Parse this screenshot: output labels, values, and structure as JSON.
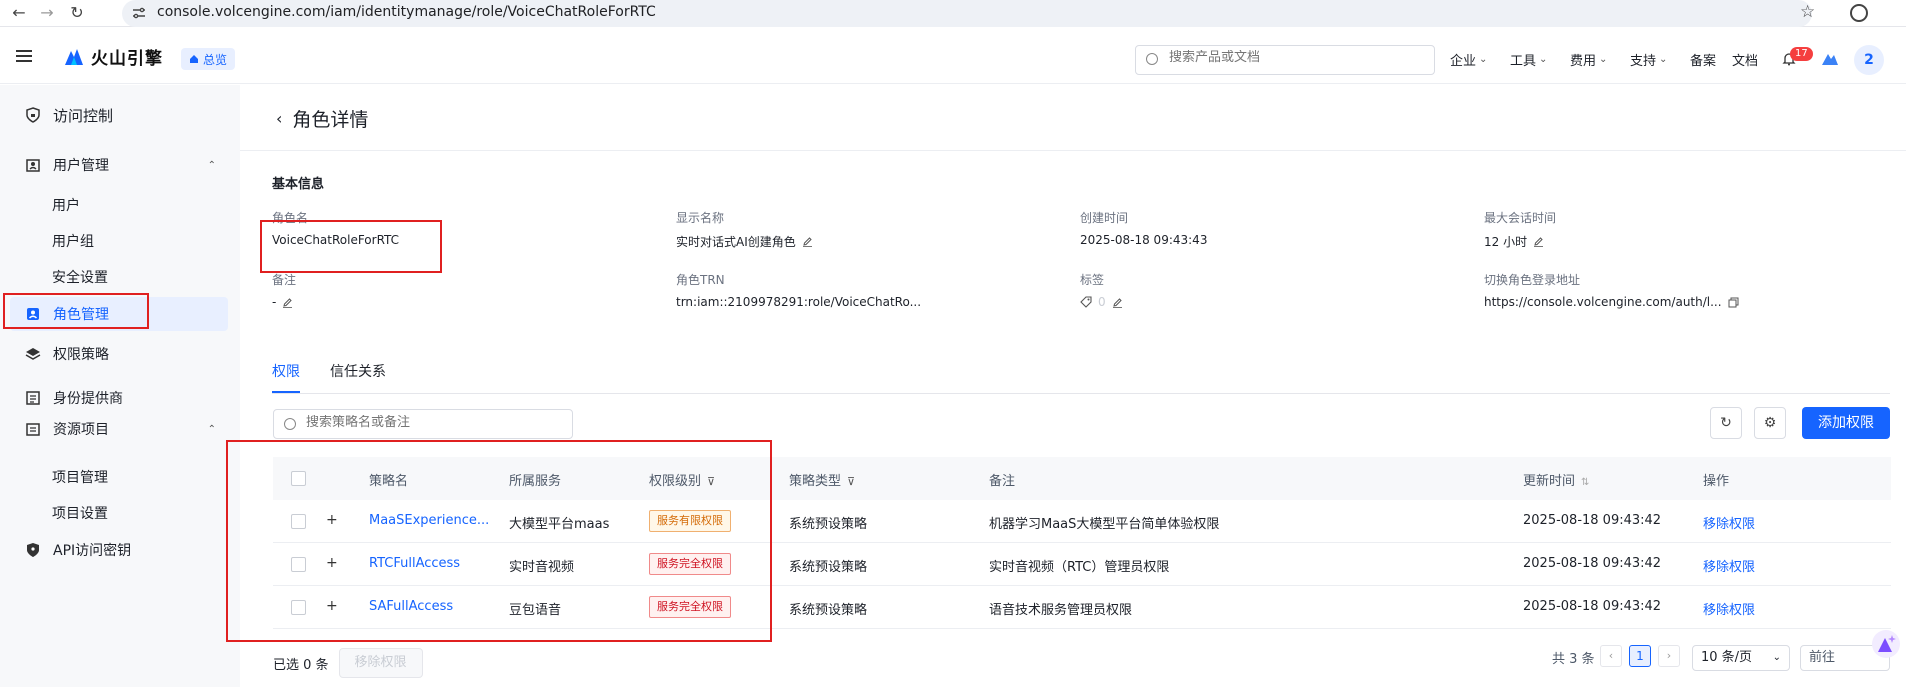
{
  "browser": {
    "url": "console.volcengine.com/iam/identitymanage/role/VoiceChatRoleForRTC"
  },
  "topnav": {
    "brand": "火山引擎",
    "overview": "总览",
    "search_placeholder": "搜索产品或文档",
    "menus": [
      "企业",
      "工具",
      "费用",
      "支持",
      "备案",
      "文档"
    ],
    "notifications": "17",
    "avatar": "2"
  },
  "sidebar": {
    "access_control": "访问控制",
    "user_mgmt": "用户管理",
    "users": "用户",
    "user_groups": "用户组",
    "security": "安全设置",
    "role_mgmt": "角色管理",
    "policies": "权限策略",
    "idp": "身份提供商",
    "resource_projects": "资源项目",
    "project_mgmt": "项目管理",
    "project_settings": "项目设置",
    "api_keys": "API访问密钥"
  },
  "page": {
    "title": "角色详情",
    "basic_info": "基本信息",
    "fields": {
      "role_name_label": "角色名",
      "role_name": "VoiceChatRoleForRTC",
      "display_name_label": "显示名称",
      "display_name": "实时对话式AI创建角色",
      "created_label": "创建时间",
      "created": "2025-08-18 09:43:43",
      "max_session_label": "最大会话时间",
      "max_session": "12 小时",
      "remark_label": "备注",
      "remark": "-",
      "trn_label": "角色TRN",
      "trn": "trn:iam::2109978291:role/VoiceChatRo...",
      "tags_label": "标签",
      "tags_count": "0",
      "switch_url_label": "切换角色登录地址",
      "switch_url": "https://console.volcengine.com/auth/l..."
    },
    "tabs": [
      "权限",
      "信任关系"
    ],
    "policy_search_placeholder": "搜索策略名或备注",
    "add_permission": "添加权限"
  },
  "table": {
    "headers": [
      "策略名",
      "所属服务",
      "权限级别",
      "策略类型",
      "备注",
      "更新时间",
      "操作"
    ],
    "rows": [
      {
        "name": "MaaSExperience...",
        "service": "大模型平台maas",
        "level": "服务有限权限",
        "type": "系统预设策略",
        "remark": "机器学习MaaS大模型平台简单体验权限",
        "updated": "2025-08-18 09:43:42",
        "action": "移除权限"
      },
      {
        "name": "RTCFullAccess",
        "service": "实时音视频",
        "level": "服务完全权限",
        "type": "系统预设策略",
        "remark": "实时音视频（RTC）管理员权限",
        "updated": "2025-08-18 09:43:42",
        "action": "移除权限"
      },
      {
        "name": "SAFullAccess",
        "service": "豆包语音",
        "level": "服务完全权限",
        "type": "系统预设策略",
        "remark": "语音技术服务管理员权限",
        "updated": "2025-08-18 09:43:42",
        "action": "移除权限"
      }
    ]
  },
  "footer": {
    "selected": "已选 0 条",
    "remove_btn": "移除权限",
    "total": "共 3 条",
    "page": "1",
    "page_size": "10 条/页",
    "goto": "前往"
  },
  "colors": {
    "accent": "#1664ff",
    "annotation": "#e02020"
  }
}
